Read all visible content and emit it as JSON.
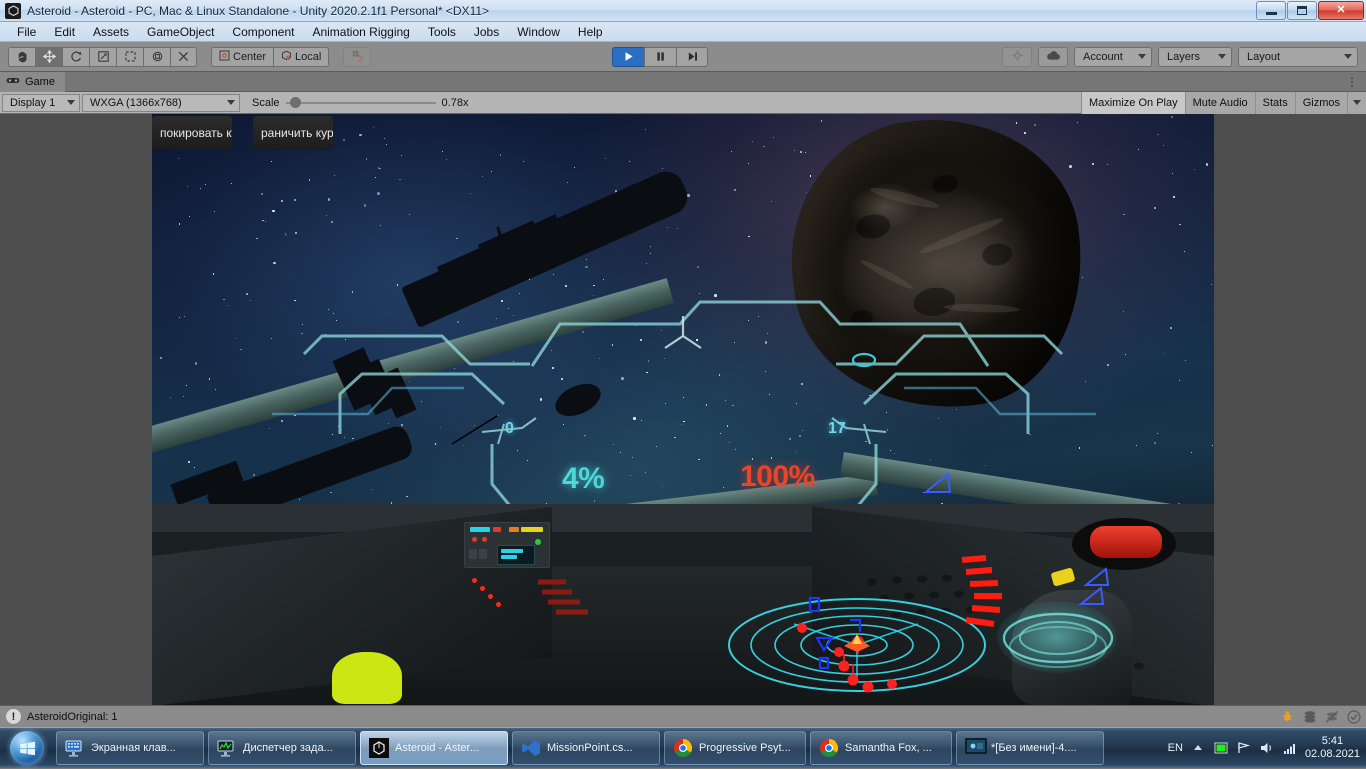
{
  "window": {
    "title": "Asteroid - Asteroid - PC, Mac & Linux Standalone - Unity 2020.2.1f1 Personal* <DX11>",
    "app_icon": "unity-icon",
    "minimize_label": "Minimize",
    "maximize_label": "Maximize",
    "close_label": "Close"
  },
  "menubar": {
    "items": [
      {
        "label": "File"
      },
      {
        "label": "Edit"
      },
      {
        "label": "Assets"
      },
      {
        "label": "GameObject"
      },
      {
        "label": "Component"
      },
      {
        "label": "Animation Rigging"
      },
      {
        "label": "Tools"
      },
      {
        "label": "Jobs"
      },
      {
        "label": "Window"
      },
      {
        "label": "Help"
      }
    ]
  },
  "toolbar": {
    "tools": [
      {
        "name": "hand-tool",
        "icon": "hand-icon",
        "selected": false
      },
      {
        "name": "move-tool",
        "icon": "move-icon",
        "selected": true
      },
      {
        "name": "rotate-tool",
        "icon": "rotate-icon",
        "selected": false
      },
      {
        "name": "scale-tool",
        "icon": "scale-icon",
        "selected": false
      },
      {
        "name": "rect-tool",
        "icon": "rect-icon",
        "selected": false
      },
      {
        "name": "transform-tool",
        "icon": "transform-icon",
        "selected": false
      },
      {
        "name": "custom-tool",
        "icon": "wrench-icon",
        "selected": false
      }
    ],
    "pivot_label": "Center",
    "pivot_icon": "pivot-center-icon",
    "handle_label": "Local",
    "handle_icon": "handle-local-icon",
    "grid_snap_icon": "grid-snap-icon",
    "play_label": "Play",
    "pause_label": "Pause",
    "step_label": "Step",
    "play_active": true,
    "collab_icon": "collab-icon",
    "cloud_icon": "cloud-icon",
    "account_label": "Account",
    "layers_label": "Layers",
    "layout_label": "Layout"
  },
  "gametab": {
    "label": "Game",
    "icon": "gamepad-icon",
    "menu_icon": "kebab-menu-icon"
  },
  "gamebar": {
    "display_label": "Display 1",
    "resolution_label": "WXGA (1366x768)",
    "scale_label": "Scale",
    "scale_value": "0.78x",
    "maximize_on_play_label": "Maximize On Play",
    "mute_audio_label": "Mute Audio",
    "stats_label": "Stats",
    "gizmos_label": "Gizmos"
  },
  "game": {
    "ui_buttons": [
      {
        "label": "покировать кур"
      },
      {
        "label": "раничить курс"
      }
    ],
    "hud": {
      "left_value": "0",
      "right_value": "17",
      "shield_percent": "4%",
      "hull_percent": "100%"
    },
    "colors": {
      "hud_cyan": "#6ed7e8",
      "shield_cyan": "#4fd6d6",
      "hull_red": "#e8452a",
      "radar_cyan": "#3ce1f0",
      "blip_red": "#ff2020",
      "blip_blue": "#1a36ff"
    }
  },
  "statusbar": {
    "message": "AsteroidOriginal: 1",
    "icon": "warning-icon",
    "right_icons": [
      {
        "name": "debug-bug-icon"
      },
      {
        "name": "stack-icon"
      },
      {
        "name": "no-stack-icon"
      },
      {
        "name": "check-circle-icon"
      }
    ]
  },
  "taskbar": {
    "start_label": "Start",
    "start_icon": "windows-orb-icon",
    "items": [
      {
        "label": "Экранная клав...",
        "icon": "onscreen-keyboard-icon",
        "active": false
      },
      {
        "label": "Диспетчер зада...",
        "icon": "task-manager-icon",
        "active": false
      },
      {
        "label": "Asteroid - Aster...",
        "icon": "unity-icon",
        "active": true
      },
      {
        "label": "MissionPoint.cs...",
        "icon": "visual-studio-icon",
        "active": false
      },
      {
        "label": "Progressive Psyt...",
        "icon": "chrome-icon",
        "active": false
      },
      {
        "label": "Samantha Fox, ...",
        "icon": "chrome-icon",
        "active": false
      },
      {
        "label": "*[Без имени]-4....",
        "icon": "media-icon",
        "active": false
      }
    ],
    "tray": {
      "language": "EN",
      "icons": [
        {
          "name": "show-hidden-icons-icon"
        },
        {
          "name": "green-monitor-icon"
        },
        {
          "name": "action-center-flag-icon"
        },
        {
          "name": "volume-icon"
        },
        {
          "name": "network-signal-icon"
        }
      ],
      "time": "5:41",
      "date": "02.08.2021"
    }
  }
}
